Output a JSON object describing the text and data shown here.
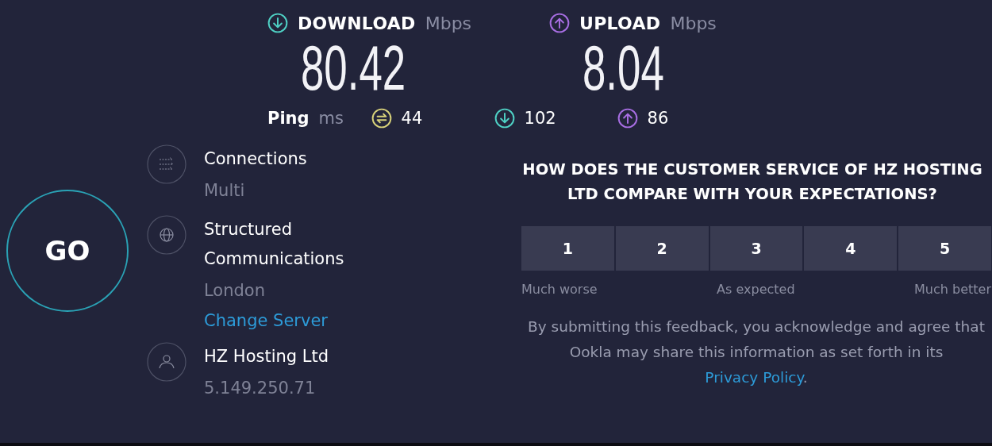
{
  "speeds": [
    {
      "kind": "download",
      "label": "DOWNLOAD",
      "unit": "Mbps",
      "value": "80.42"
    },
    {
      "kind": "upload",
      "label": "UPLOAD",
      "unit": "Mbps",
      "value": "8.04"
    }
  ],
  "ping": {
    "label": "Ping",
    "unit": "ms",
    "readings": [
      {
        "kind": "idle",
        "value": "44"
      },
      {
        "kind": "download",
        "value": "102"
      },
      {
        "kind": "upload",
        "value": "86"
      }
    ]
  },
  "go_button": "GO",
  "servers": [
    {
      "kind": "connections",
      "title": "Connections",
      "subtitle": "Multi"
    },
    {
      "kind": "server",
      "title": "Structured Communications",
      "subtitle": "London",
      "link": "Change Server"
    },
    {
      "kind": "host",
      "title": "HZ Hosting Ltd",
      "subtitle": "5.149.250.71"
    }
  ],
  "feedback": {
    "question": "HOW DOES THE CUSTOMER SERVICE OF HZ HOSTING LTD COMPARE WITH YOUR EXPECTATIONS?",
    "options": [
      {
        "label": "1",
        "selected": false
      },
      {
        "label": "2",
        "selected": false
      },
      {
        "label": "3",
        "selected": false
      },
      {
        "label": "4",
        "selected": false
      },
      {
        "label": "5",
        "selected": false
      }
    ],
    "scale_labels": [
      "Much worse",
      "As expected",
      "Much better"
    ],
    "disclaimer": "By submitting this feedback, you acknowledge and agree that Ookla may share this information as set forth in its",
    "privacy_link": "Privacy Policy",
    "disclaimer_end": "."
  }
}
